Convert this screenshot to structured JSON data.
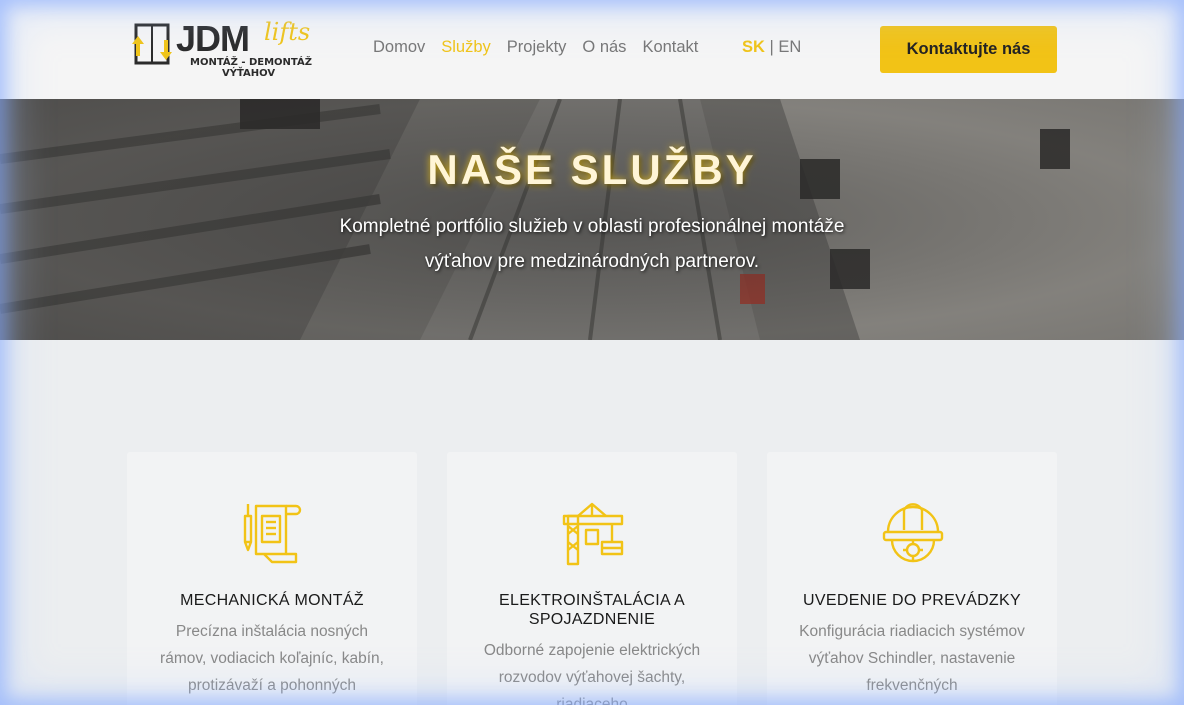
{
  "header": {
    "logo": {
      "name": "JDM",
      "tagline_word": "lifts",
      "sub_line1": "MONTÁŽ - DEMONTÁŽ",
      "sub_line2": "VÝŤAHOV"
    },
    "nav": [
      {
        "label": "Domov",
        "active": false
      },
      {
        "label": "Služby",
        "active": true
      },
      {
        "label": "Projekty",
        "active": false
      },
      {
        "label": "O nás",
        "active": false
      },
      {
        "label": "Kontakt",
        "active": false
      }
    ],
    "lang": {
      "sk": "SK",
      "separator": "|",
      "en": "EN"
    },
    "cta_label": "Kontaktujte nás"
  },
  "hero": {
    "title": "NAŠE SLUŽBY",
    "subtitle": "Kompletné portfólio služieb v oblasti profesionálnej montáže výťahov pre medzinárodných partnerov."
  },
  "cards": [
    {
      "icon": "blueprint-icon",
      "title": "MECHANICKÁ MONTÁŽ",
      "text": "Precízna inštalácia nosných rámov, vodiacich koľajníc, kabín, protizávaží a pohonných"
    },
    {
      "icon": "crane-icon",
      "title": "ELEKTROINŠTALÁCIA A SPOJAZDNENIE",
      "text": "Odborné zapojenie elektrických rozvodov výťahovej šachty, riadiaceho"
    },
    {
      "icon": "hard-hat-icon",
      "title": "UVEDENIE DO PREVÁDZKY",
      "text": "Konfigurácia riadiacich systémov výťahov Schindler, nastavenie frekvenčných"
    }
  ],
  "colors": {
    "accent": "#f2c316",
    "header_bg": "#f5f5f5",
    "page_bg": "#eceef0",
    "card_bg": "#f2f3f4"
  }
}
